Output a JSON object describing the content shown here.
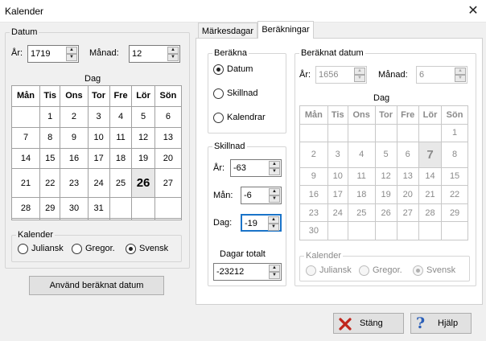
{
  "window": {
    "title": "Kalender",
    "close_glyph": "✕"
  },
  "left": {
    "group_label": "Datum",
    "year_label": "År:",
    "year_value": "1719",
    "month_label": "Månad:",
    "month_value": "12",
    "day_label": "Dag",
    "weekdays": [
      "Mån",
      "Tis",
      "Ons",
      "Tor",
      "Fre",
      "Lör",
      "Sön"
    ],
    "weeks": [
      [
        "",
        "1",
        "2",
        "3",
        "4",
        "5",
        "6"
      ],
      [
        "7",
        "8",
        "9",
        "10",
        "11",
        "12",
        "13"
      ],
      [
        "14",
        "15",
        "16",
        "17",
        "18",
        "19",
        "20"
      ],
      [
        "21",
        "22",
        "23",
        "24",
        "25",
        "26",
        "27"
      ],
      [
        "28",
        "29",
        "30",
        "31",
        "",
        "",
        ""
      ],
      [
        "",
        "",
        "",
        "",
        "",
        "",
        ""
      ]
    ],
    "selected_day": "26",
    "calendar_label": "Kalender",
    "calendar_options": [
      "Juliansk",
      "Gregor.",
      "Svensk"
    ],
    "calendar_selected": "Svensk",
    "apply_button": "Använd beräknat datum"
  },
  "tabs": [
    {
      "label": "Märkesdagar",
      "selected": false
    },
    {
      "label": "Beräkningar",
      "selected": true
    }
  ],
  "calc": {
    "group_label": "Beräkna",
    "options": [
      "Datum",
      "Skillnad",
      "Kalendrar"
    ],
    "selected": "Datum",
    "diff_label": "Skillnad",
    "year_label": "År:",
    "year_value": "-63",
    "month_label": "Mån:",
    "month_value": "-6",
    "day_label": "Dag:",
    "day_value": "-19",
    "total_label": "Dagar totalt",
    "total_value": "-23212"
  },
  "result": {
    "group_label": "Beräknat datum",
    "year_label": "År:",
    "year_value": "1656",
    "month_label": "Månad:",
    "month_value": "6",
    "day_label": "Dag",
    "weekdays": [
      "Mån",
      "Tis",
      "Ons",
      "Tor",
      "Fre",
      "Lör",
      "Sön"
    ],
    "weeks": [
      [
        "",
        "",
        "",
        "",
        "",
        "",
        "1"
      ],
      [
        "2",
        "3",
        "4",
        "5",
        "6",
        "7",
        "8"
      ],
      [
        "9",
        "10",
        "11",
        "12",
        "13",
        "14",
        "15"
      ],
      [
        "16",
        "17",
        "18",
        "19",
        "20",
        "21",
        "22"
      ],
      [
        "23",
        "24",
        "25",
        "26",
        "27",
        "28",
        "29"
      ],
      [
        "30",
        "",
        "",
        "",
        "",
        "",
        ""
      ]
    ],
    "selected_day": "7",
    "calendar_label": "Kalender",
    "calendar_options": [
      "Juliansk",
      "Gregor.",
      "Svensk"
    ],
    "calendar_selected": "Svensk"
  },
  "footer": {
    "close_button": "Stäng",
    "help_button": "Hjälp"
  },
  "colors": {
    "accent": "#1a73c8",
    "close_icon": "#c0261c",
    "help_icon": "#2b5fb8"
  }
}
